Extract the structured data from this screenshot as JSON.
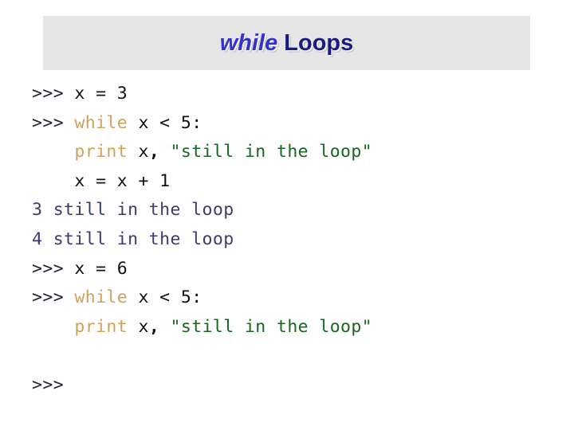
{
  "header": {
    "title_keyword": "while",
    "title_rest": " Loops",
    "band_color": "#e6e6e6",
    "keyword_color": "#3333cc",
    "rest_color": "#1a1a80"
  },
  "colors": {
    "prompt": "#232336",
    "plain": "#111111",
    "keyword": "#cfa15c",
    "string": "#17651f",
    "output": "#3b3b73",
    "background": "#ffffff"
  },
  "console": {
    "prompt": ">>> ",
    "lines": [
      {
        "id": "line-1",
        "kind": "input",
        "text": ">>> x = 3",
        "tokens": [
          {
            "t": ">>> ",
            "c": "prompt"
          },
          {
            "t": "x = 3",
            "c": "plain"
          }
        ]
      },
      {
        "id": "line-2",
        "kind": "input",
        "text": ">>> while x < 5:",
        "tokens": [
          {
            "t": ">>> ",
            "c": "prompt"
          },
          {
            "t": "while",
            "c": "keyword"
          },
          {
            "t": " x < 5:",
            "c": "plain"
          }
        ]
      },
      {
        "id": "line-3",
        "kind": "input",
        "text": "    print x, \"still in the loop\"",
        "tokens": [
          {
            "t": "    ",
            "c": "plain"
          },
          {
            "t": "print",
            "c": "keyword"
          },
          {
            "t": " x",
            "c": "plain"
          },
          {
            "t": ",",
            "c": "punct"
          },
          {
            "t": " ",
            "c": "plain"
          },
          {
            "t": "\"still in the loop\"",
            "c": "string"
          }
        ]
      },
      {
        "id": "line-4",
        "kind": "input",
        "text": "    x = x + 1",
        "tokens": [
          {
            "t": "    x = x + 1",
            "c": "plain"
          }
        ]
      },
      {
        "id": "line-5",
        "kind": "output",
        "text": "3 still in the loop",
        "tokens": [
          {
            "t": "3 still in the loop",
            "c": "output"
          }
        ]
      },
      {
        "id": "line-6",
        "kind": "output",
        "text": "4 still in the loop",
        "tokens": [
          {
            "t": "4 still in the loop",
            "c": "output"
          }
        ]
      },
      {
        "id": "line-7",
        "kind": "input",
        "text": ">>> x = 6",
        "tokens": [
          {
            "t": ">>> ",
            "c": "prompt"
          },
          {
            "t": "x = 6",
            "c": "plain"
          }
        ]
      },
      {
        "id": "line-8",
        "kind": "input",
        "text": ">>> while x < 5:",
        "tokens": [
          {
            "t": ">>> ",
            "c": "prompt"
          },
          {
            "t": "while",
            "c": "keyword"
          },
          {
            "t": " x < 5:",
            "c": "plain"
          }
        ]
      },
      {
        "id": "line-9",
        "kind": "input",
        "text": "    print x, \"still in the loop\"",
        "tokens": [
          {
            "t": "    ",
            "c": "plain"
          },
          {
            "t": "print",
            "c": "keyword"
          },
          {
            "t": " x",
            "c": "plain"
          },
          {
            "t": ",",
            "c": "punct"
          },
          {
            "t": " ",
            "c": "plain"
          },
          {
            "t": "\"still in the loop\"",
            "c": "string"
          }
        ]
      },
      {
        "id": "line-10",
        "kind": "blank",
        "text": "",
        "tokens": []
      },
      {
        "id": "line-11",
        "kind": "prompt",
        "text": ">>>",
        "tokens": [
          {
            "t": ">>>",
            "c": "prompt"
          }
        ]
      }
    ]
  }
}
